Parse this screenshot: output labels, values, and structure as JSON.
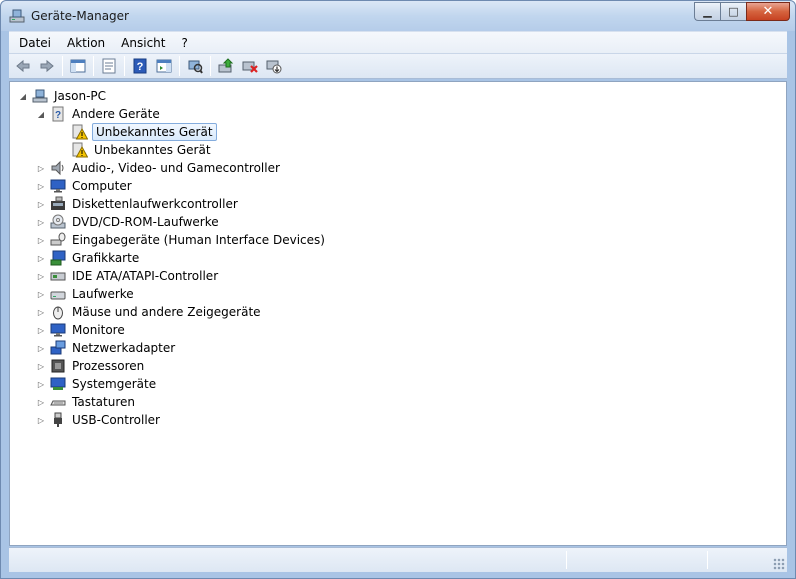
{
  "window": {
    "title": "Geräte-Manager",
    "controls": {
      "minimize": "▁",
      "maximize": "□",
      "close": "✕"
    }
  },
  "menubar": {
    "items": [
      {
        "label": "Datei"
      },
      {
        "label": "Aktion"
      },
      {
        "label": "Ansicht"
      },
      {
        "label": "?"
      }
    ]
  },
  "toolbar": {
    "buttons": [
      {
        "icon": "back-arrow-icon"
      },
      {
        "icon": "forward-arrow-icon"
      },
      {
        "icon": "show-hide-console-tree-icon"
      },
      {
        "icon": "properties-icon"
      },
      {
        "icon": "help-icon"
      },
      {
        "icon": "show-hide-action-pane-icon"
      },
      {
        "icon": "scan-hardware-icon"
      },
      {
        "icon": "update-driver-icon"
      },
      {
        "icon": "uninstall-icon"
      },
      {
        "icon": "disable-device-icon"
      }
    ]
  },
  "tree": {
    "root": {
      "label": "Jason-PC",
      "icon": "computer-icon",
      "expanded": true
    },
    "groups": [
      {
        "label": "Andere Geräte",
        "icon": "unknown-device-icon",
        "expanded": true,
        "children": [
          {
            "label": "Unbekanntes Gerät",
            "icon": "warning-device-icon",
            "selected": true
          },
          {
            "label": "Unbekanntes Gerät",
            "icon": "warning-device-icon",
            "selected": false
          }
        ]
      },
      {
        "label": "Audio-, Video- und Gamecontroller",
        "icon": "speaker-icon",
        "expanded": false
      },
      {
        "label": "Computer",
        "icon": "monitor-icon",
        "expanded": false
      },
      {
        "label": "Diskettenlaufwerkcontroller",
        "icon": "floppy-controller-icon",
        "expanded": false
      },
      {
        "label": "DVD/CD-ROM-Laufwerke",
        "icon": "dvd-drive-icon",
        "expanded": false
      },
      {
        "label": "Eingabegeräte (Human Interface Devices)",
        "icon": "hid-icon",
        "expanded": false
      },
      {
        "label": "Grafikkarte",
        "icon": "display-adapter-icon",
        "expanded": false
      },
      {
        "label": "IDE ATA/ATAPI-Controller",
        "icon": "ide-controller-icon",
        "expanded": false
      },
      {
        "label": "Laufwerke",
        "icon": "disk-drive-icon",
        "expanded": false
      },
      {
        "label": "Mäuse und andere Zeigegeräte",
        "icon": "mouse-icon",
        "expanded": false
      },
      {
        "label": "Monitore",
        "icon": "monitor-icon",
        "expanded": false
      },
      {
        "label": "Netzwerkadapter",
        "icon": "network-adapter-icon",
        "expanded": false
      },
      {
        "label": "Prozessoren",
        "icon": "processor-icon",
        "expanded": false
      },
      {
        "label": "Systemgeräte",
        "icon": "system-devices-icon",
        "expanded": false
      },
      {
        "label": "Tastaturen",
        "icon": "keyboard-icon",
        "expanded": false
      },
      {
        "label": "USB-Controller",
        "icon": "usb-icon",
        "expanded": false
      }
    ]
  },
  "colors": {
    "selection_border": "#84acdd",
    "warning_yellow": "#f5c400",
    "title_gradient_top": "#dbe7f6",
    "close_button": "#c74222"
  }
}
